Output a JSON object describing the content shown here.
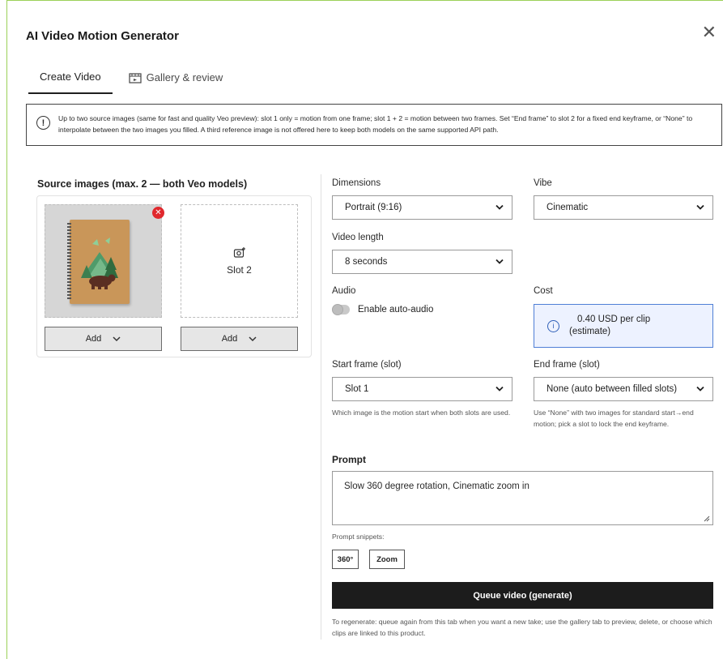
{
  "window": {
    "title": "AI Video Motion Generator",
    "close_glyph": "✕"
  },
  "tabs": [
    {
      "label": "Create Video",
      "active": true
    },
    {
      "label": "Gallery & review",
      "active": false,
      "icon": "film-icon"
    }
  ],
  "info": {
    "text": "Up to two source images (same for fast and quality Veo preview): slot 1 only = motion from one frame; slot 1 + 2 = motion between two frames. Set “End frame” to slot 2 for a fixed end keyframe, or “None” to interpolate between the two images you filled. A third reference image is not offered here to keep both models on the same supported API path."
  },
  "source": {
    "title": "Source images (max. 2 — both Veo models)",
    "slot2_label": "Slot 2",
    "add_label_1": "Add",
    "add_label_2": "Add"
  },
  "dimensions": {
    "label": "Dimensions",
    "value": "Portrait (9:16)"
  },
  "vibe": {
    "label": "Vibe",
    "value": "Cinematic"
  },
  "video_length": {
    "label": "Video length",
    "value": "8 seconds"
  },
  "audio": {
    "label": "Audio",
    "toggle_label": "Enable auto-audio",
    "enabled": false
  },
  "cost": {
    "label": "Cost",
    "line1": "0.40 USD per clip",
    "line2": "(estimate)"
  },
  "start_frame": {
    "label": "Start frame (slot)",
    "value": "Slot 1",
    "help": "Which image is the motion start when both slots are used."
  },
  "end_frame": {
    "label": "End frame (slot)",
    "value": "None (auto between filled slots)",
    "help": "Use “None” with two images for standard start→end motion; pick a slot to lock the end keyframe."
  },
  "prompt": {
    "title": "Prompt",
    "value": "Slow 360 degree rotation, Cinematic zoom in",
    "snippets_label": "Prompt snippets:",
    "snippets": [
      "360°",
      "Zoom"
    ]
  },
  "queue": {
    "label": "Queue video (generate)",
    "help": "To regenerate: queue again from this tab when you want a new take; use the gallery tab to preview, delete, or choose which clips are linked to this product."
  },
  "colors": {
    "accent_border": "#9bd158",
    "cost_bg": "#edf2ff",
    "cost_border": "#4f7fd6",
    "remove_red": "#e0282d",
    "primary_button": "#1c1c1c"
  }
}
